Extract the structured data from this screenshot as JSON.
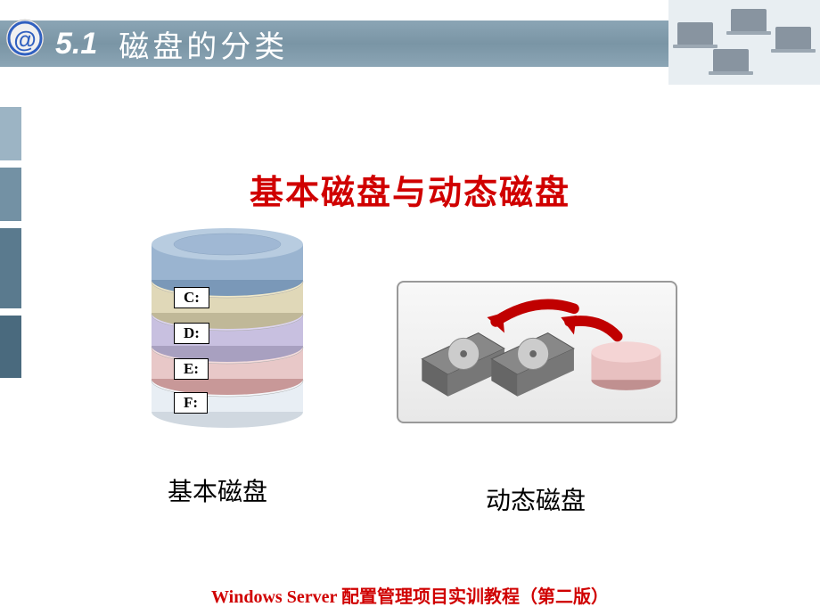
{
  "header": {
    "number": "5.1",
    "title": "磁盘的分类"
  },
  "subtitle": "基本磁盘与动态磁盘",
  "basic": {
    "label": "基本磁盘",
    "drives": {
      "c": "C:",
      "d": "D:",
      "e": "E:",
      "f": "F:"
    }
  },
  "dynamic": {
    "label": "动态磁盘"
  },
  "footer": "Windows Server 配置管理项目实训教程（第二版）"
}
